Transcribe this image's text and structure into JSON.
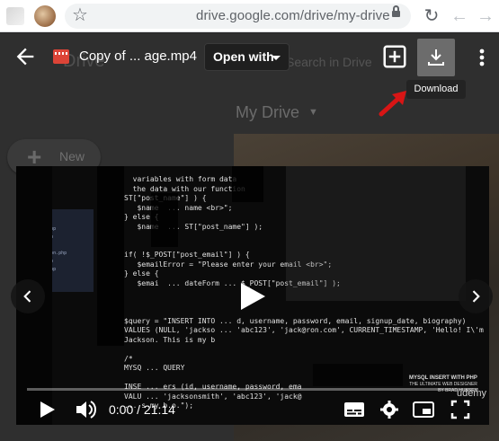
{
  "browser": {
    "url": "drive.google.com/drive/my-drive"
  },
  "drive_background": {
    "new_button_label": "New",
    "search_placeholder": "Search in Drive",
    "page_title": "My Drive"
  },
  "viewer": {
    "file_title": "Copy of ... age.mp4",
    "open_with_label": "Open with",
    "download_tooltip": "Download"
  },
  "video": {
    "time_display": "0:00 / 21:14",
    "progress": 0.0,
    "code_lines": [
      "  variables with form data",
      "  the data with our function",
      "ST[\"post_name\"] ) {",
      "   $name  ... name <br>\";",
      "} else {",
      "   $name  ... ST[\"post_name\"] );",
      "",
      "",
      "if( !$_POST[\"post_email\"] ) {",
      "   $emailError = \"Please enter your email <br>\";",
      "} else {",
      "   $emai  ... dateForm ... $_POST[\"post_email\"] );",
      "",
      "",
      "",
      "$query = \"INSERT INTO ... d, username, password, email, signup_date, biography)",
      "VALUES (NULL, 'jackso ... 'abc123', 'jack@ron.com', CURRENT_TIMESTAMP, 'Hello! I\\'m",
      "Jackson. This is my b",
      "",
      "/*",
      "MYSQ ... QUERY",
      "",
      "INSE ... ers (id, username, password, ema",
      "VALU ... 'jacksonsmith', 'abc123', 'jack@",
      "... s my b.o.\");"
    ],
    "sidebar_files": [
      "php",
      "",
      "signup.php",
      "index.php",
      "",
      "connection.php",
      "index.php",
      "insert.php"
    ],
    "watermark_lines": [
      "MYSQL INSERT WITH PHP",
      "THE ULTIMATE WEB DESIGNER",
      "BY BRAD HUSSEY"
    ],
    "brand": "udemy"
  },
  "colors": {
    "accent_progress": "#ff3e3e",
    "download_bg": "#6c6c6c",
    "arrow_red": "#d81515"
  },
  "icons": [
    "back-arrow-icon",
    "video-file-icon",
    "add-to-drive-icon",
    "download-icon",
    "more-vert-icon",
    "play-icon",
    "volume-icon",
    "subtitles-icon",
    "settings-icon",
    "pip-icon",
    "fullscreen-icon"
  ]
}
